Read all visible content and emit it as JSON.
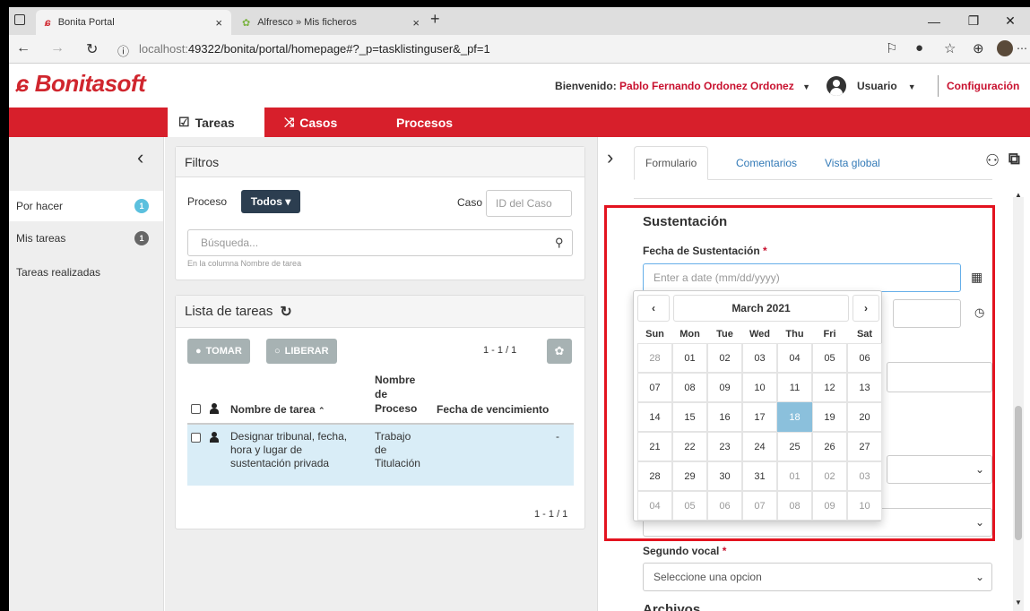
{
  "browser": {
    "tabs": [
      {
        "label": "Bonita Portal",
        "close": "×"
      },
      {
        "label": "Alfresco » Mis ficheros",
        "close": "×"
      }
    ],
    "new_tab": "+",
    "url_prefix": "localhost:",
    "url_rest": "49322/bonita/portal/homepage#?_p=tasklistinguser&_pf=1",
    "win_min": "—",
    "win_max": "❐",
    "win_close": "✕"
  },
  "header": {
    "logo": "Bonitasoft",
    "welcome_label": "Bienvenido:",
    "user_name": "Pablo Fernando Ordonez Ordonez",
    "role": "Usuario",
    "config": "Configuración"
  },
  "nav": {
    "tabs": [
      {
        "label": "Tareas",
        "icon": "☑"
      },
      {
        "label": "Casos",
        "icon": "⤨"
      },
      {
        "label": "Procesos",
        "icon": ""
      }
    ]
  },
  "sidebar": {
    "items": [
      {
        "label": "Por hacer",
        "count": "1",
        "color": "#5bc0de"
      },
      {
        "label": "Mis tareas",
        "count": "1",
        "color": "#666666"
      },
      {
        "label": "Tareas realizadas",
        "count": "",
        "color": ""
      }
    ]
  },
  "filters": {
    "title": "Filtros",
    "process_label": "Proceso",
    "process_value": "Todos ▾",
    "case_label": "Caso",
    "case_placeholder": "ID del Caso",
    "search_placeholder": "Búsqueda...",
    "search_hint": "En la columna Nombre de tarea"
  },
  "tasklist": {
    "title": "Lista de tareas",
    "take": "TOMAR",
    "release": "LIBERAR",
    "pagination": "1 - 1 / 1",
    "columns": {
      "name": "Nombre de tarea",
      "process_l1": "Nombre",
      "process_l2": "de",
      "process_l3": "Proceso",
      "due": "Fecha de vencimiento"
    },
    "row": {
      "name_l1": "Designar tribunal, fecha,",
      "name_l2": "hora y lugar de",
      "name_l3": "sustentación privada",
      "proc_l1": "Trabajo",
      "proc_l2": "de",
      "proc_l3": "Titulación",
      "due": "-"
    },
    "pagination_bottom": "1 - 1 / 1"
  },
  "rightpanel": {
    "tabs": [
      "Formulario",
      "Comentarios",
      "Vista global"
    ],
    "section_title": "Sustentación",
    "date_label": "Fecha de Sustentación",
    "date_placeholder": "Enter a date (mm/dd/yyyy)",
    "second_vocal_label": "Segundo vocal",
    "select_placeholder": "Seleccione una opcion",
    "archivos": "Archivos"
  },
  "datepicker": {
    "month": "March 2021",
    "dow": [
      "Sun",
      "Mon",
      "Tue",
      "Wed",
      "Thu",
      "Fri",
      "Sat"
    ],
    "weeks": [
      [
        "28",
        "01",
        "02",
        "03",
        "04",
        "05",
        "06"
      ],
      [
        "07",
        "08",
        "09",
        "10",
        "11",
        "12",
        "13"
      ],
      [
        "14",
        "15",
        "16",
        "17",
        "18",
        "19",
        "20"
      ],
      [
        "21",
        "22",
        "23",
        "24",
        "25",
        "26",
        "27"
      ],
      [
        "28",
        "29",
        "30",
        "31",
        "01",
        "02",
        "03"
      ],
      [
        "04",
        "05",
        "06",
        "07",
        "08",
        "09",
        "10"
      ]
    ],
    "selected": "18"
  }
}
